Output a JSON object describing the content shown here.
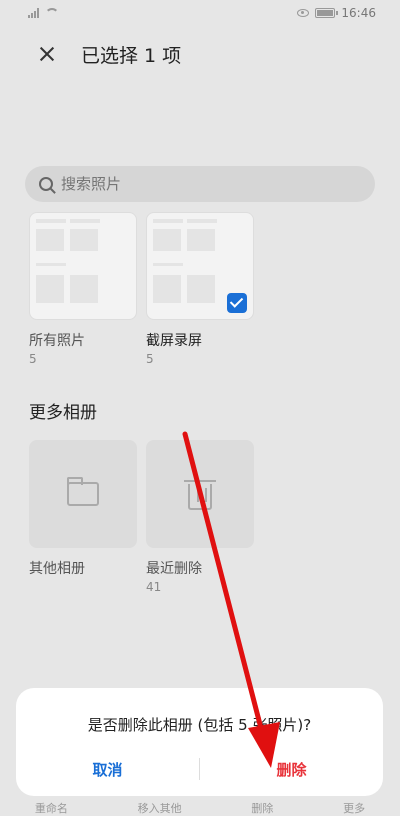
{
  "status": {
    "time": "16:46"
  },
  "header": {
    "title": "已选择 1 项"
  },
  "search": {
    "placeholder": "搜索照片"
  },
  "albums": [
    {
      "name": "所有照片",
      "count": "5"
    },
    {
      "name": "截屏录屏",
      "count": "5"
    }
  ],
  "more_section": {
    "title": "更多相册"
  },
  "more_albums": [
    {
      "name": "其他相册",
      "count": ""
    },
    {
      "name": "最近删除",
      "count": "41"
    }
  ],
  "bottom_bar": [
    "重命名",
    "移入其他",
    "删除",
    "更多"
  ],
  "dialog": {
    "message": "是否删除此相册 (包括 5 张照片)?",
    "cancel": "取消",
    "delete": "删除"
  },
  "colors": {
    "accent": "#1a6fd6",
    "danger": "#e8333a",
    "arrow": "#e01010"
  }
}
